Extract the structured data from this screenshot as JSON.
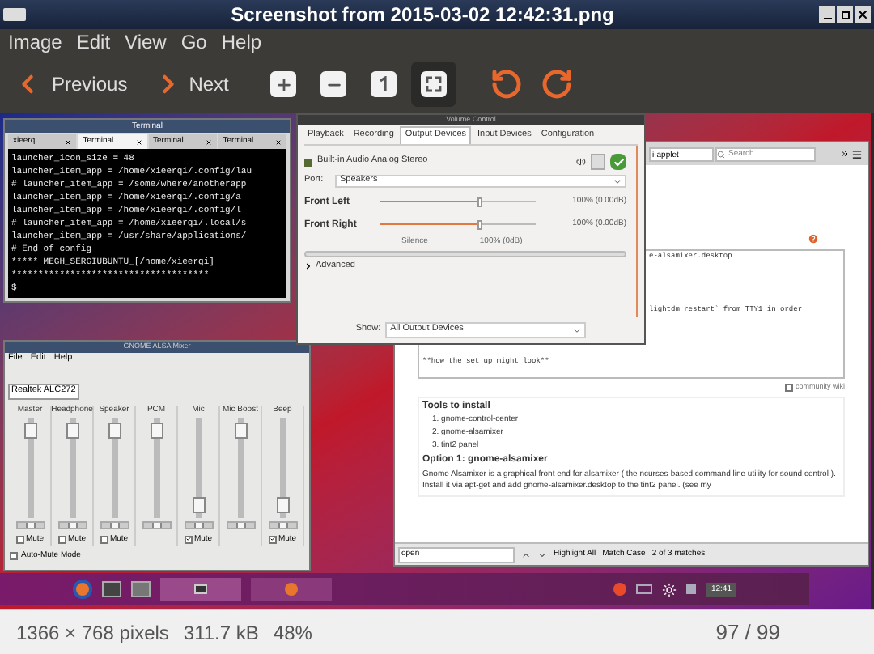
{
  "window": {
    "title": "Screenshot from 2015-03-02 12:42:31.png"
  },
  "menu": [
    "Image",
    "Edit",
    "View",
    "Go",
    "Help"
  ],
  "toolbar": {
    "previous": "Previous",
    "next": "Next",
    "tools": [
      {
        "kind": "zoom-in",
        "selected": false
      },
      {
        "kind": "zoom-out",
        "selected": false
      },
      {
        "kind": "normal-size",
        "selected": false
      },
      {
        "kind": "best-fit",
        "selected": true
      },
      {
        "kind": "rotate-left",
        "selected": false
      },
      {
        "kind": "rotate-right",
        "selected": false
      }
    ]
  },
  "screenshot": {
    "terminal": {
      "title": "Terminal",
      "tabs": [
        {
          "label": "xieerq",
          "selected": false
        },
        {
          "label": "Terminal",
          "selected": true
        },
        {
          "label": "Terminal",
          "selected": false
        },
        {
          "label": "Terminal",
          "selected": false
        }
      ],
      "lines": [
        "launcher_icon_size = 48",
        "launcher_item_app = /home/xieerqi/.config/lau",
        "# launcher_item_app = /some/where/anotherapp",
        "launcher_item_app = /home/xieerqi/.config/a",
        "launcher_item_app = /home/xieerqi/.config/l",
        "# launcher_item_app = /home/xieerqi/.local/s",
        "launcher_item_app = /usr/share/applications/",
        "# End of config",
        "***** MEGH_SERGIUBUNTU_[/home/xieerqi]",
        "*************************************",
        "$"
      ]
    },
    "sound": {
      "title": "Volume Control",
      "tabs": [
        {
          "label": "Playback",
          "selected": false
        },
        {
          "label": "Recording",
          "selected": false
        },
        {
          "label": "Output Devices",
          "selected": true
        },
        {
          "label": "Input Devices",
          "selected": false
        },
        {
          "label": "Configuration",
          "selected": false
        }
      ],
      "device": "Built-in Audio Analog Stereo",
      "port_label": "Port:",
      "port": "Speakers",
      "channels": [
        {
          "name": "Front Left",
          "level": 0.64,
          "reading": "100% (0.00dB)"
        },
        {
          "name": "Front Right",
          "level": 0.64,
          "reading": "100% (0.00dB)"
        }
      ],
      "marks": [
        "Silence",
        "100% (0dB)"
      ],
      "advanced": "Advanced",
      "show_label": "Show:",
      "show": "All Output Devices"
    },
    "mixer": {
      "title": "GNOME ALSA Mixer",
      "menu": [
        "File",
        "Edit",
        "Help"
      ],
      "card": "Realtek ALC272",
      "channels": [
        {
          "name": "Master",
          "level": 0.95,
          "balance": {
            "level": 0.5
          },
          "muted": false,
          "mute_label": "Mute"
        },
        {
          "name": "Headphone",
          "level": 0.95,
          "balance": {
            "level": 0.5
          },
          "muted": false,
          "mute_label": "Mute"
        },
        {
          "name": "Speaker",
          "level": 0.95,
          "balance": {
            "level": 0.5
          },
          "muted": false,
          "mute_label": "Mute"
        },
        {
          "name": "PCM",
          "level": 0.95,
          "balance": {
            "level": 0.5
          }
        },
        {
          "name": "Mic",
          "level": 0.05,
          "balance": {
            "level": 0.5
          },
          "muted": true,
          "mute_label": "Mute"
        },
        {
          "name": "Mic Boost",
          "level": 0.95,
          "balance": {
            "level": 0.5
          }
        },
        {
          "name": "Beep",
          "level": 0.05,
          "balance": {
            "level": 0.5
          },
          "muted": true,
          "mute_label": "Mute"
        }
      ],
      "auto_mute": {
        "label": "Auto-Mute Mode",
        "checked": false
      }
    },
    "browser": {
      "address": "i-applet",
      "search": {
        "placeholder": "Search"
      },
      "editor_lines": [
        {
          "text": "e-alsamixer.desktop",
          "kind": "partial"
        },
        {
          "text": "lightdm restart` from TTY1 in order",
          "kind": "partial"
        },
        {
          "text": "**how the set up might look**",
          "kind": "full"
        }
      ],
      "community_wiki": {
        "label": "community wiki",
        "checked": false
      },
      "heading": "Tools to install",
      "list": [
        "1. gnome-control-center",
        "2. gnome-alsamixer",
        "3. tint2 panel"
      ],
      "subheading": "Option 1: gnome-alsamixer",
      "paragraph": "Gnome Alsamixer is a graphical front end for alsamixer ( the ncurses-based command line utility for sound control ). Install it via apt-get and add gnome-alsamixer.desktop to the tint2 panel. (see my",
      "find": {
        "value": "open",
        "highlight": "Highlight All",
        "match_case": "Match Case",
        "result": "2 of 3 matches"
      }
    },
    "taskbar": {
      "clock": "12:41"
    }
  },
  "status_bar": {
    "dimensions": "1366 × 768 pixels",
    "size": "311.7 kB",
    "zoom": "48%",
    "position": "97 / 99"
  }
}
